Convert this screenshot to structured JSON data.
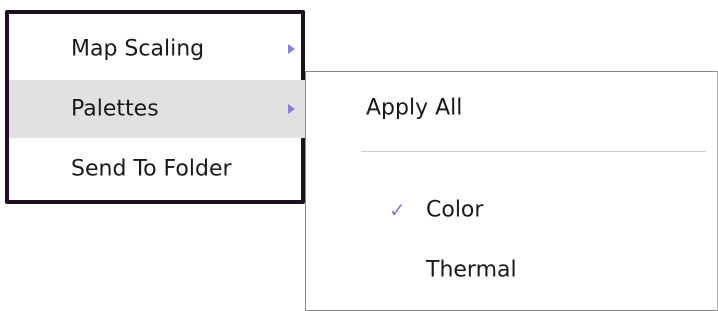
{
  "menu": {
    "items": [
      {
        "label": "Map Scaling",
        "has_submenu": true,
        "highlighted": false
      },
      {
        "label": "Palettes",
        "has_submenu": true,
        "highlighted": true
      },
      {
        "label": "Send To Folder",
        "has_submenu": false,
        "highlighted": false
      }
    ]
  },
  "submenu": {
    "apply_all_label": "Apply All",
    "options": [
      {
        "label": "Color",
        "checked": true,
        "check_icon": "✓"
      },
      {
        "label": "Thermal",
        "checked": false
      }
    ]
  },
  "colors": {
    "accent": "#8a7fd8",
    "highlight": "#e1e1e1",
    "menu_border": "#1e1020"
  }
}
